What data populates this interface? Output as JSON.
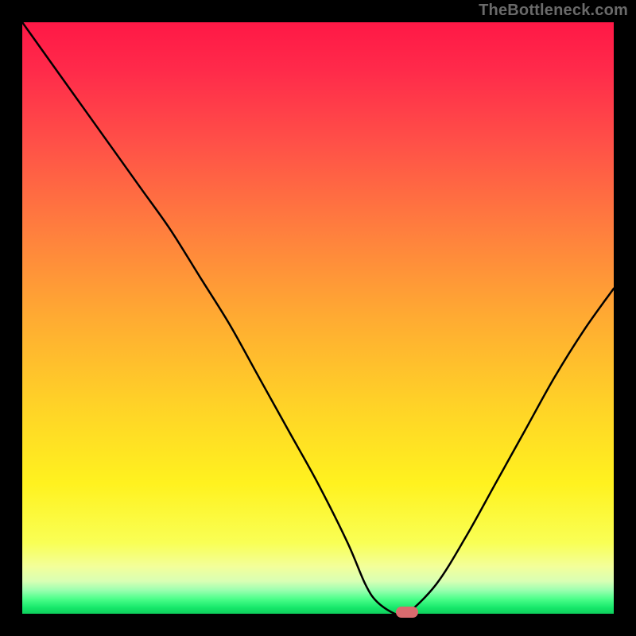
{
  "attribution": "TheBottleneck.com",
  "chart_data": {
    "type": "line",
    "title": "",
    "xlabel": "",
    "ylabel": "",
    "xlim": [
      0,
      100
    ],
    "ylim": [
      0,
      100
    ],
    "legend": false,
    "grid": false,
    "background": "vertical rainbow gradient (red→orange→yellow→green) with narrow bright-green band near bottom",
    "series": [
      {
        "name": "bottleneck-curve",
        "color": "#000000",
        "x": [
          0,
          5,
          10,
          15,
          20,
          25,
          30,
          35,
          40,
          45,
          50,
          55,
          58,
          60,
          63,
          65,
          70,
          75,
          80,
          85,
          90,
          95,
          100
        ],
        "y": [
          100,
          93,
          86,
          79,
          72,
          65,
          57,
          49,
          40,
          31,
          22,
          12,
          5,
          2,
          0,
          0,
          5,
          13,
          22,
          31,
          40,
          48,
          55
        ]
      }
    ],
    "annotations": [
      {
        "name": "target-marker",
        "shape": "rounded-rect",
        "color": "#d96b6e",
        "x": 65,
        "y": 0
      }
    ],
    "gradient_stops": [
      {
        "offset": 0.0,
        "color": "#ff1846"
      },
      {
        "offset": 0.08,
        "color": "#ff2a4a"
      },
      {
        "offset": 0.2,
        "color": "#ff4f48"
      },
      {
        "offset": 0.35,
        "color": "#ff7e3e"
      },
      {
        "offset": 0.5,
        "color": "#ffab32"
      },
      {
        "offset": 0.65,
        "color": "#ffd327"
      },
      {
        "offset": 0.78,
        "color": "#fff21f"
      },
      {
        "offset": 0.88,
        "color": "#f9ff55"
      },
      {
        "offset": 0.92,
        "color": "#f3ff9a"
      },
      {
        "offset": 0.945,
        "color": "#d9ffb4"
      },
      {
        "offset": 0.96,
        "color": "#9cffb0"
      },
      {
        "offset": 0.975,
        "color": "#4cff8a"
      },
      {
        "offset": 0.99,
        "color": "#16e76a"
      },
      {
        "offset": 1.0,
        "color": "#0fcf5c"
      }
    ]
  }
}
